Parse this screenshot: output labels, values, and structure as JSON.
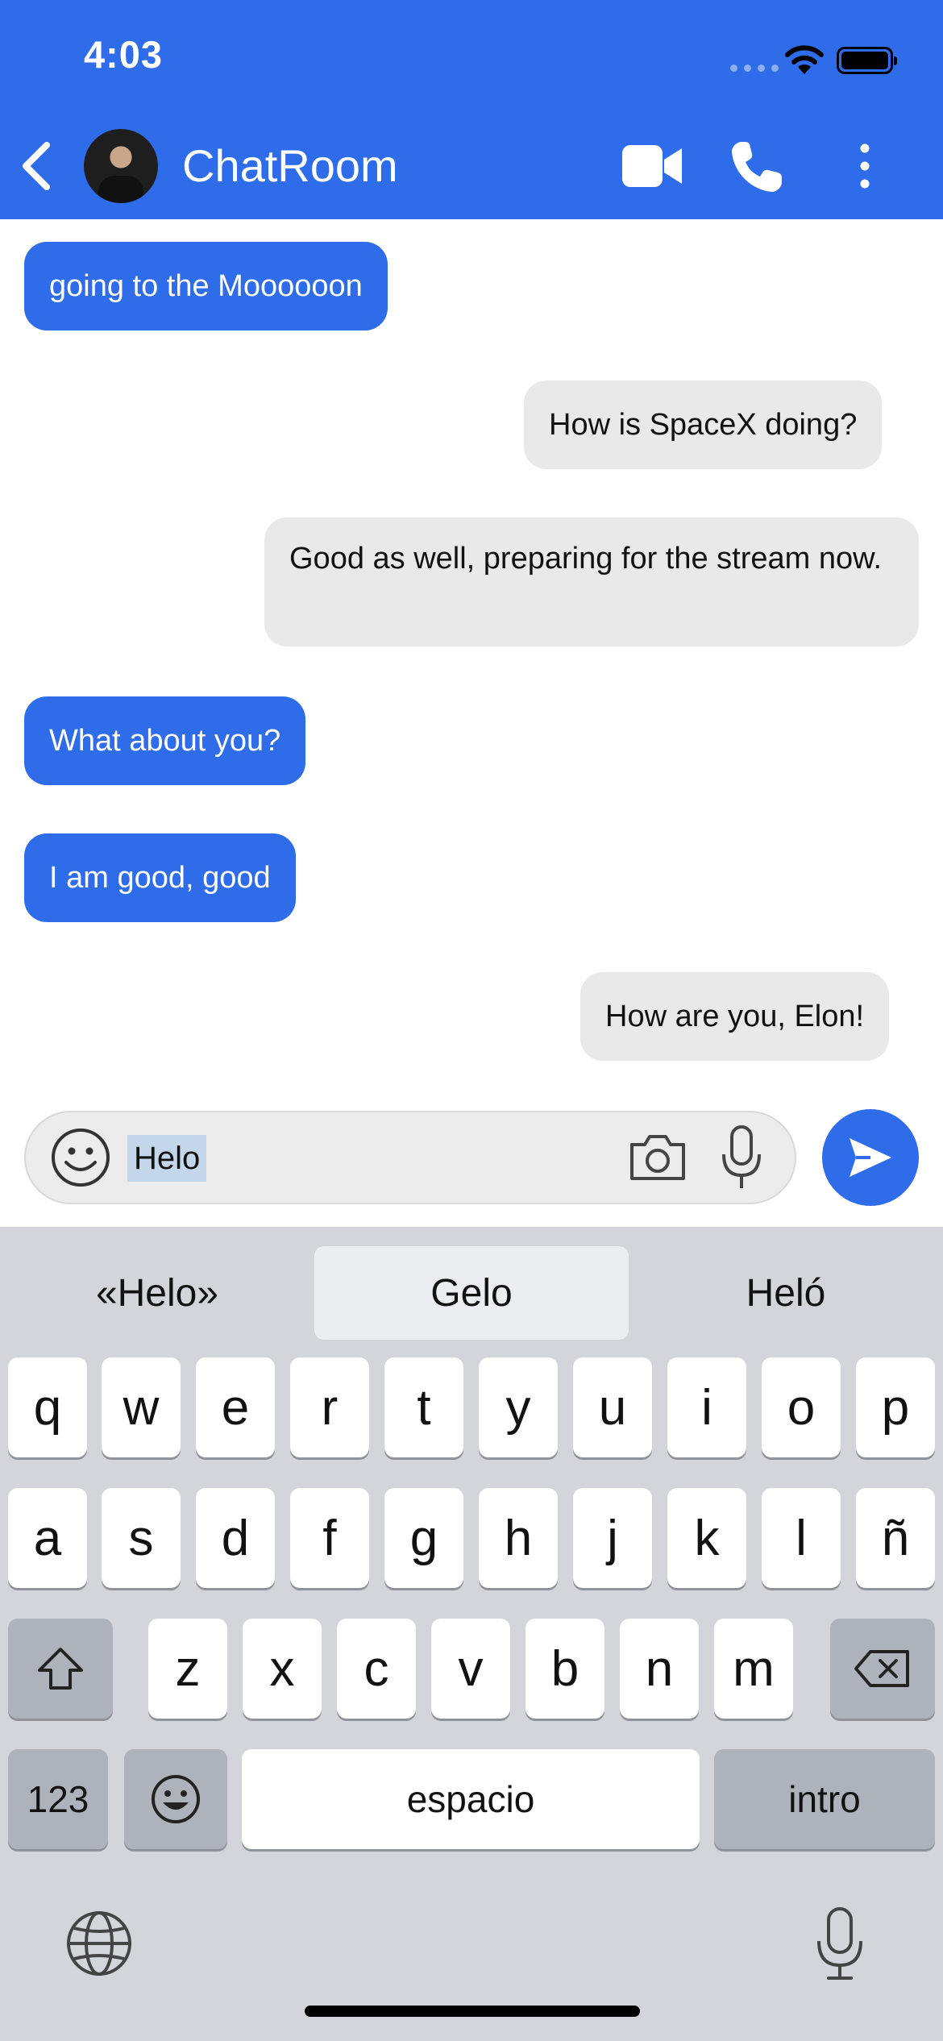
{
  "status_bar": {
    "time": "4:03"
  },
  "header": {
    "title": "ChatRoom",
    "icons": [
      "back-icon",
      "avatar",
      "video-icon",
      "phone-icon",
      "more-icon"
    ]
  },
  "messages": [
    {
      "text": "going to the Moooooon",
      "side": "in"
    },
    {
      "text": "How is SpaceX doing?",
      "side": "out"
    },
    {
      "text": "Good as well, preparing for the stream now.",
      "side": "out"
    },
    {
      "text": "What about you?",
      "side": "in"
    },
    {
      "text": "I am good, good",
      "side": "in"
    },
    {
      "text": "How are you, Elon!",
      "side": "out"
    }
  ],
  "composer": {
    "value": "Helo",
    "icons": [
      "emoji-icon",
      "camera-icon",
      "microphone-icon",
      "send-icon"
    ]
  },
  "keyboard": {
    "suggestions": [
      "«Helo»",
      "Gelo",
      "Heló"
    ],
    "row1": [
      "q",
      "w",
      "e",
      "r",
      "t",
      "y",
      "u",
      "i",
      "o",
      "p"
    ],
    "row2": [
      "a",
      "s",
      "d",
      "f",
      "g",
      "h",
      "j",
      "k",
      "l",
      "ñ"
    ],
    "row3": [
      "z",
      "x",
      "c",
      "v",
      "b",
      "n",
      "m"
    ],
    "numbers": "123",
    "space": "espacio",
    "return": "intro"
  },
  "colors": {
    "accent": "#2f6ce9",
    "incoming_bubble": "#2f6ce9",
    "outgoing_bubble": "#e9e9e9",
    "keyboard_bg": "#d3d5db"
  }
}
